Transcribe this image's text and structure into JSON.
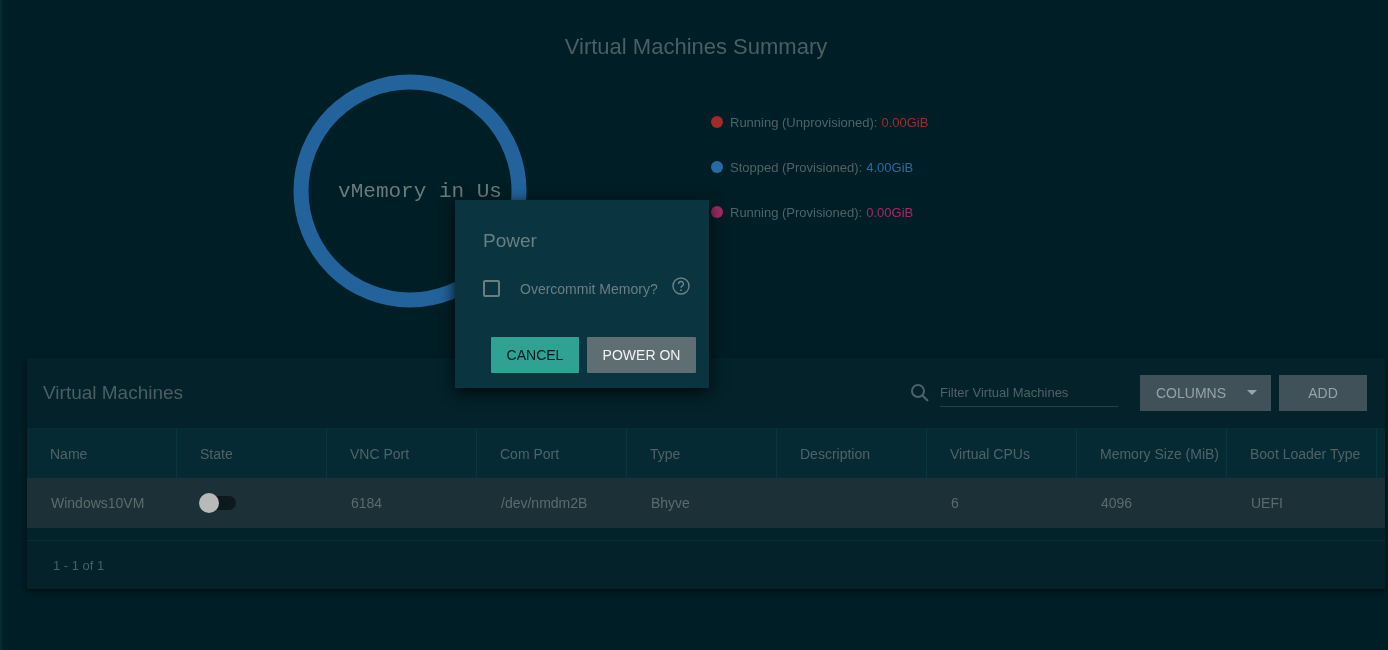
{
  "summary": {
    "title": "Virtual Machines Summary",
    "center_label": "vMemory in Us",
    "legend": [
      {
        "label": "Running (Unprovisioned):",
        "value": "0.00GiB",
        "color": "#a32a2a"
      },
      {
        "label": "Stopped (Provisioned):",
        "value": "4.00GiB",
        "color": "#2a6aa3"
      },
      {
        "label": "Running (Provisioned):",
        "value": "0.00GiB",
        "color": "#a32a63"
      }
    ]
  },
  "dialog": {
    "title": "Power",
    "checkbox": {
      "label": "Overcommit Memory?",
      "checked": false
    },
    "buttons": [
      {
        "label": "CANCEL",
        "kind": "primary"
      },
      {
        "label": "POWER ON",
        "kind": "secondary"
      }
    ]
  },
  "table": {
    "title": "Virtual Machines",
    "filter": {
      "placeholder": "Filter Virtual Machines"
    },
    "columns_button": "COLUMNS",
    "add_button": "ADD",
    "columns": [
      "Name",
      "State",
      "VNC Port",
      "Com Port",
      "Type",
      "Description",
      "Virtual CPUs",
      "Memory Size (MiB)",
      "Boot Loader Type"
    ],
    "rows": [
      {
        "cells": [
          "Windows10VM",
          "",
          "6184",
          "/dev/nmdm2B",
          "Bhyve",
          "",
          "6",
          "4096",
          "UEFI"
        ],
        "on": false
      }
    ],
    "pagination": "1 - 1 of 1"
  }
}
